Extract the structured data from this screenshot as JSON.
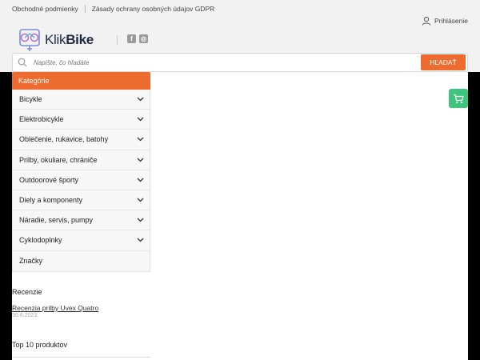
{
  "topbar": {
    "links": [
      "Obchodné podmienky",
      "Zásady ochrany osobných údajov GDPR"
    ],
    "login_label": "Prihlásenie"
  },
  "logo": {
    "part1": "Klik",
    "part2": "Bike"
  },
  "social": {
    "facebook": "f",
    "instagram": "◎"
  },
  "search": {
    "placeholder": "Napíšte, čo hľadáte",
    "button_label": "HĽADAŤ"
  },
  "categories": {
    "heading": "Kategórie",
    "items": [
      {
        "label": "Bicykle",
        "has_chevron": true
      },
      {
        "label": "Elektrobicykle",
        "has_chevron": true
      },
      {
        "label": "Oblečenie, rukavice, batohy",
        "has_chevron": true
      },
      {
        "label": "Prilby, okuliare, chrániče",
        "has_chevron": true
      },
      {
        "label": "Outdoorové športy",
        "has_chevron": true
      },
      {
        "label": "Diely a komponenty",
        "has_chevron": true
      },
      {
        "label": "Náradie, servis, pumpy",
        "has_chevron": true
      },
      {
        "label": "Cyklodoplnky",
        "has_chevron": true
      },
      {
        "label": "Značky",
        "has_chevron": false
      }
    ]
  },
  "reviews": {
    "heading": "Recenzie",
    "item_title": "Recenzia prilby Uvex Quatro",
    "item_date": "30.6.2023"
  },
  "top_products": {
    "heading": "Top 10 produktov"
  },
  "colors": {
    "accent": "#ee6b2f",
    "cart": "#3ec47c",
    "brand_dark": "#1f2a44"
  }
}
